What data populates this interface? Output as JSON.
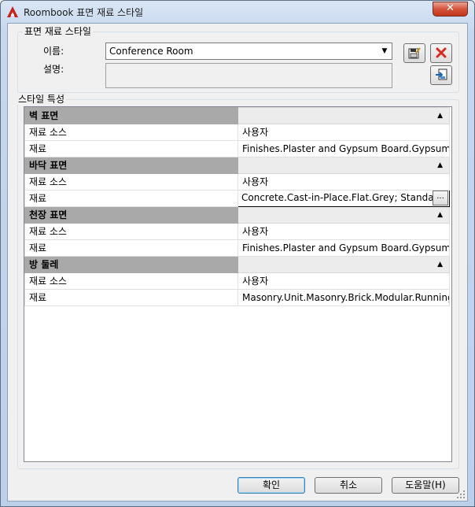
{
  "window": {
    "title": "Roombook 표면 재료 스타일",
    "close_glyph": "✕",
    "icon": "autocad-a-icon"
  },
  "surface_style": {
    "group_title": "표면 재료 스타일",
    "name_label": "이름:",
    "name_value": "Conference Room",
    "description_label": "설명:",
    "description_value": "",
    "icons": {
      "save": "save-icon",
      "delete": "delete-icon",
      "import": "import-icon"
    }
  },
  "style_properties": {
    "group_title": "스타일 특성",
    "categories": [
      {
        "title": "벽 표면",
        "rows": [
          {
            "label": "재료 소스",
            "value": "사용자"
          },
          {
            "label": "재료",
            "value": "Finishes.Plaster and Gypsum Board.Gypsum Wall"
          }
        ]
      },
      {
        "title": "바닥 표면",
        "rows": [
          {
            "label": "재료 소스",
            "value": "사용자"
          },
          {
            "label": "재료",
            "value": "Concrete.Cast-in-Place.Flat.Grey; Standard",
            "editing": true
          }
        ]
      },
      {
        "title": "천장 표면",
        "rows": [
          {
            "label": "재료 소스",
            "value": "사용자"
          },
          {
            "label": "재료",
            "value": "Finishes.Plaster and Gypsum Board.Gypsum Wall"
          }
        ]
      },
      {
        "title": "방 둘레",
        "rows": [
          {
            "label": "재료 소스",
            "value": "사용자"
          },
          {
            "label": "재료",
            "value": "Masonry.Unit.Masonry.Brick.Modular.Running"
          }
        ]
      }
    ],
    "collapse_glyph": "▲",
    "browse_glyph": "..."
  },
  "buttons": {
    "ok": "확인",
    "cancel": "취소",
    "help": "도움말(H)"
  },
  "colors": {
    "category_header": "#a9a9a9",
    "delete_red": "#d62b1f",
    "default_button_border": "#3c7fb1"
  }
}
